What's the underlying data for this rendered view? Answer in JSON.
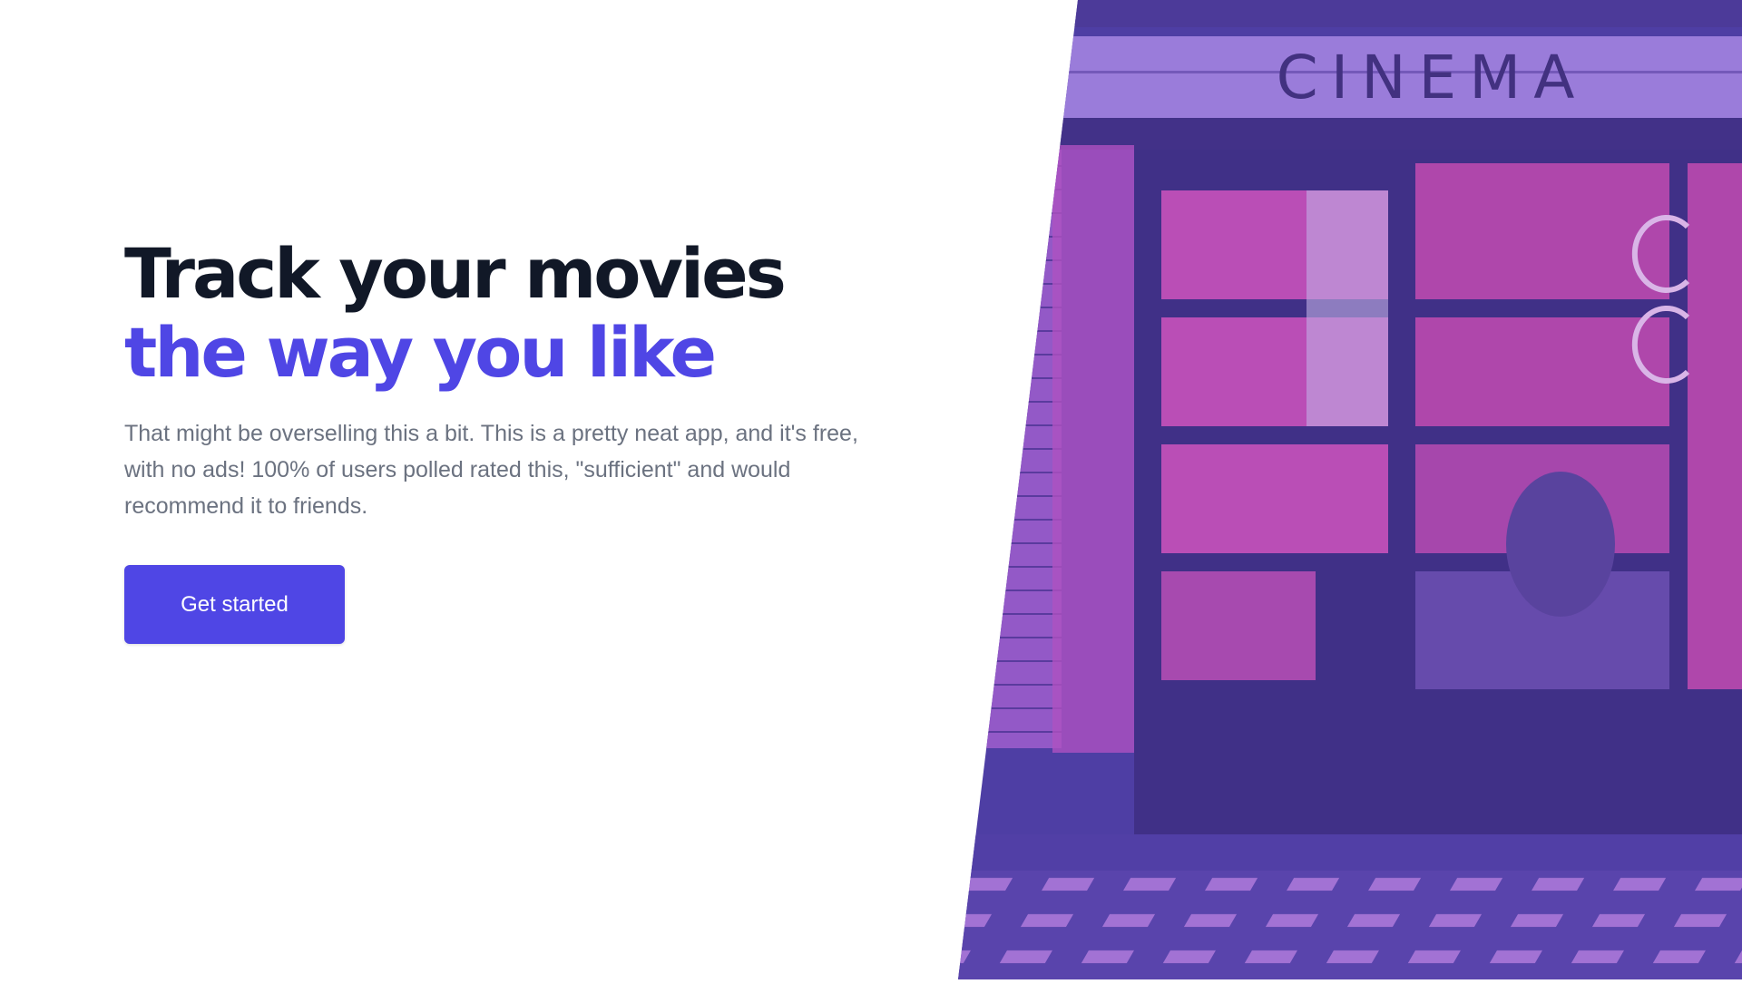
{
  "hero": {
    "title_line1": "Track your movies",
    "title_line2": "the way you like",
    "description": "That might be overselling this a bit. This is a pretty neat app, and it's free, with no ads! 100% of users polled rated this, \"sufficient\" and would recommend it to friends.",
    "cta_label": "Get started"
  },
  "photo": {
    "sign_text": "CINEMA"
  },
  "colors": {
    "accent": "#4f46e5",
    "heading": "#111827",
    "body_text": "#6b7280",
    "photo_overlay": "#4c3f9e"
  }
}
